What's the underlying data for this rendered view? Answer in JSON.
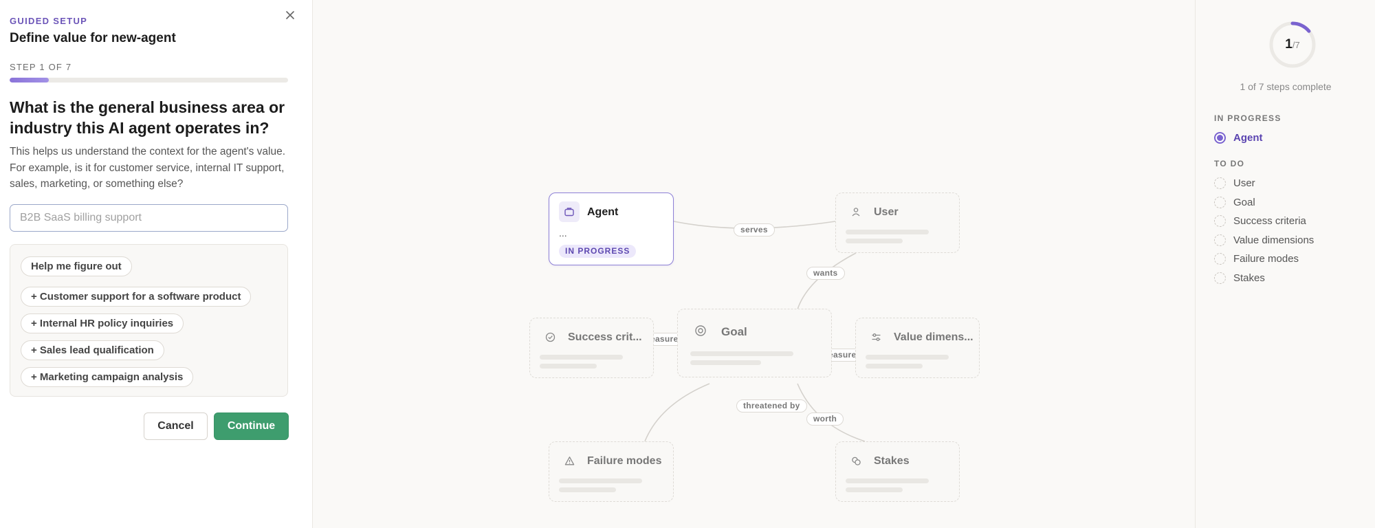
{
  "wizard": {
    "eyebrow": "GUIDED SETUP",
    "title": "Define value for new-agent",
    "step_label": "STEP 1 OF 7",
    "progress": 0.14,
    "question": "What is the general business area or industry this AI agent operates in?",
    "help_text": "This helps us understand the context for the agent's value. For example, is it for customer service, internal IT support, sales, marketing, or something else?",
    "input": {
      "value": "",
      "placeholder": "B2B SaaS billing support"
    },
    "help_button": "Help me figure out",
    "suggestions": [
      "+ Customer support for a software product",
      "+ Internal HR policy inquiries",
      "+ Sales lead qualification",
      "+ Marketing campaign analysis"
    ],
    "cancel_label": "Cancel",
    "continue_label": "Continue"
  },
  "graph": {
    "nodes": {
      "agent": {
        "title": "Agent",
        "ellipsis": "...",
        "badge": "IN PROGRESS",
        "icon": "briefcase-icon"
      },
      "user": {
        "title": "User",
        "icon": "person-icon"
      },
      "goal": {
        "title": "Goal",
        "icon": "target-icon"
      },
      "success": {
        "title": "Success crit...",
        "icon": "check-circle-icon"
      },
      "value": {
        "title": "Value dimens...",
        "icon": "sliders-icon"
      },
      "failure": {
        "title": "Failure modes",
        "icon": "warning-icon"
      },
      "stakes": {
        "title": "Stakes",
        "icon": "coins-icon"
      }
    },
    "edges": {
      "serves": "serves",
      "wants": "wants",
      "measured_left": "measured",
      "measured_right": "measured",
      "threatened": "threatened by",
      "worth": "worth"
    }
  },
  "progress_panel": {
    "completed": "1",
    "total": "/7",
    "fraction": 0.14,
    "steps_complete": "1 of 7 steps complete",
    "in_progress_label": "IN PROGRESS",
    "current_step": "Agent",
    "todo_label": "TO DO",
    "todo_steps": [
      "User",
      "Goal",
      "Success criteria",
      "Value dimensions",
      "Failure modes",
      "Stakes"
    ]
  },
  "colors": {
    "accent": "#7a63cf",
    "primary_button": "#3e9d6e"
  }
}
